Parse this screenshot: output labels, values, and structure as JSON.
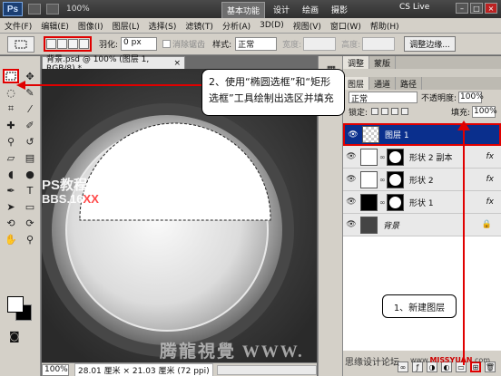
{
  "titlebar": {
    "logo": "Ps",
    "zoom": "100%",
    "workspaces": [
      "基本功能",
      "设计",
      "绘画",
      "摄影"
    ],
    "active_workspace": "基本功能",
    "cs_live": "CS Live"
  },
  "menu": [
    "文件(F)",
    "编辑(E)",
    "图像(I)",
    "图层(L)",
    "选择(S)",
    "滤镜(T)",
    "分析(A)",
    "3D(D)",
    "视图(V)",
    "窗口(W)",
    "帮助(H)"
  ],
  "options": {
    "feather_label": "羽化:",
    "feather_value": "0 px",
    "antialias_label": "消除锯齿",
    "style_label": "样式:",
    "style_value": "正常",
    "width_label": "宽度:",
    "height_label": "高度:",
    "refine_edge": "调整边缘..."
  },
  "document": {
    "tab_title": "背景.psd @ 100% (图层 1, RGB/8) *",
    "tab_close": "×",
    "zoom": "100%",
    "doc_info": "28.01 厘米 × 21.03 厘米 (72 ppi)"
  },
  "callouts": {
    "step2": "2、使用“椭圆选框”和“矩形选框”工具绘制出选区并填充",
    "step1": "1、新建图层"
  },
  "watermarks": {
    "overlay_line1": "PS教程论坛",
    "overlay_line2_a": "BBS.16",
    "overlay_line2_b": "XX",
    "overlay_line2_c": "8",
    "big": "腾龍視覺 WWW.",
    "bottom_cn": "思缘设计论坛",
    "bottom_url_a": "www.",
    "bottom_url_b": "MISSYUAN",
    "bottom_url_c": ".com"
  },
  "panels": {
    "top_tabs": [
      "调整",
      "蒙版"
    ],
    "layer_tabs": [
      "图层",
      "通道",
      "路径"
    ],
    "blend_mode": "正常",
    "opacity_label": "不透明度:",
    "opacity_value": "100%",
    "lock_label": "锁定:",
    "fill_label": "填充:",
    "fill_value": "100%",
    "layers": [
      {
        "name": "图层 1",
        "fx": ""
      },
      {
        "name": "形状 2 副本",
        "fx": "fx"
      },
      {
        "name": "形状 2",
        "fx": "fx"
      },
      {
        "name": "形状 1",
        "fx": "fx"
      },
      {
        "name": "背景",
        "fx": ""
      }
    ]
  },
  "icons": {
    "eye": "eye-icon",
    "lock": "lock-icon",
    "marquee": "rect-marquee-icon",
    "move": "move-icon"
  },
  "colors": {
    "highlight_red": "#e00000",
    "selected_layer": "#0a2f8d"
  }
}
